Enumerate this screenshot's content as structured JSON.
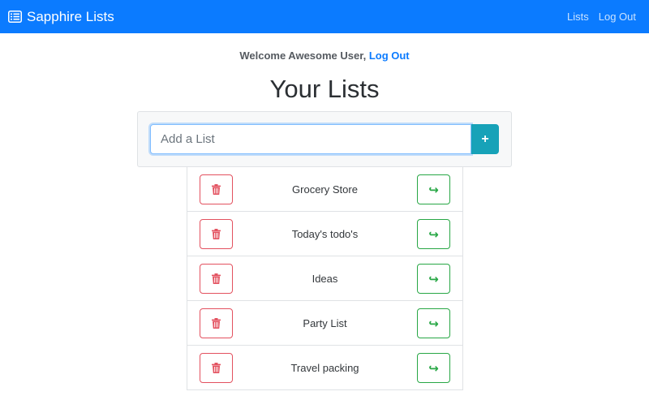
{
  "navbar": {
    "brand": "Sapphire Lists",
    "brand_icon": "list-icon",
    "links": [
      "Lists",
      "Log Out"
    ]
  },
  "welcome": {
    "greeting": "Welcome Awesome User,",
    "logout_link": "Log Out"
  },
  "page_title": "Your Lists",
  "add_list": {
    "placeholder": "Add a List",
    "value": "",
    "button_label": "+"
  },
  "lists": [
    {
      "name": "Grocery Store"
    },
    {
      "name": "Today's todo's"
    },
    {
      "name": "Ideas"
    },
    {
      "name": "Party List"
    },
    {
      "name": "Travel packing"
    }
  ],
  "icons": {
    "delete": "trash-icon",
    "open": "arrow-right-hook-icon",
    "open_glyph": "↪"
  },
  "colors": {
    "primary": "#0b7bff",
    "info": "#17a2b8",
    "danger": "#e3515f",
    "success": "#28a745"
  }
}
